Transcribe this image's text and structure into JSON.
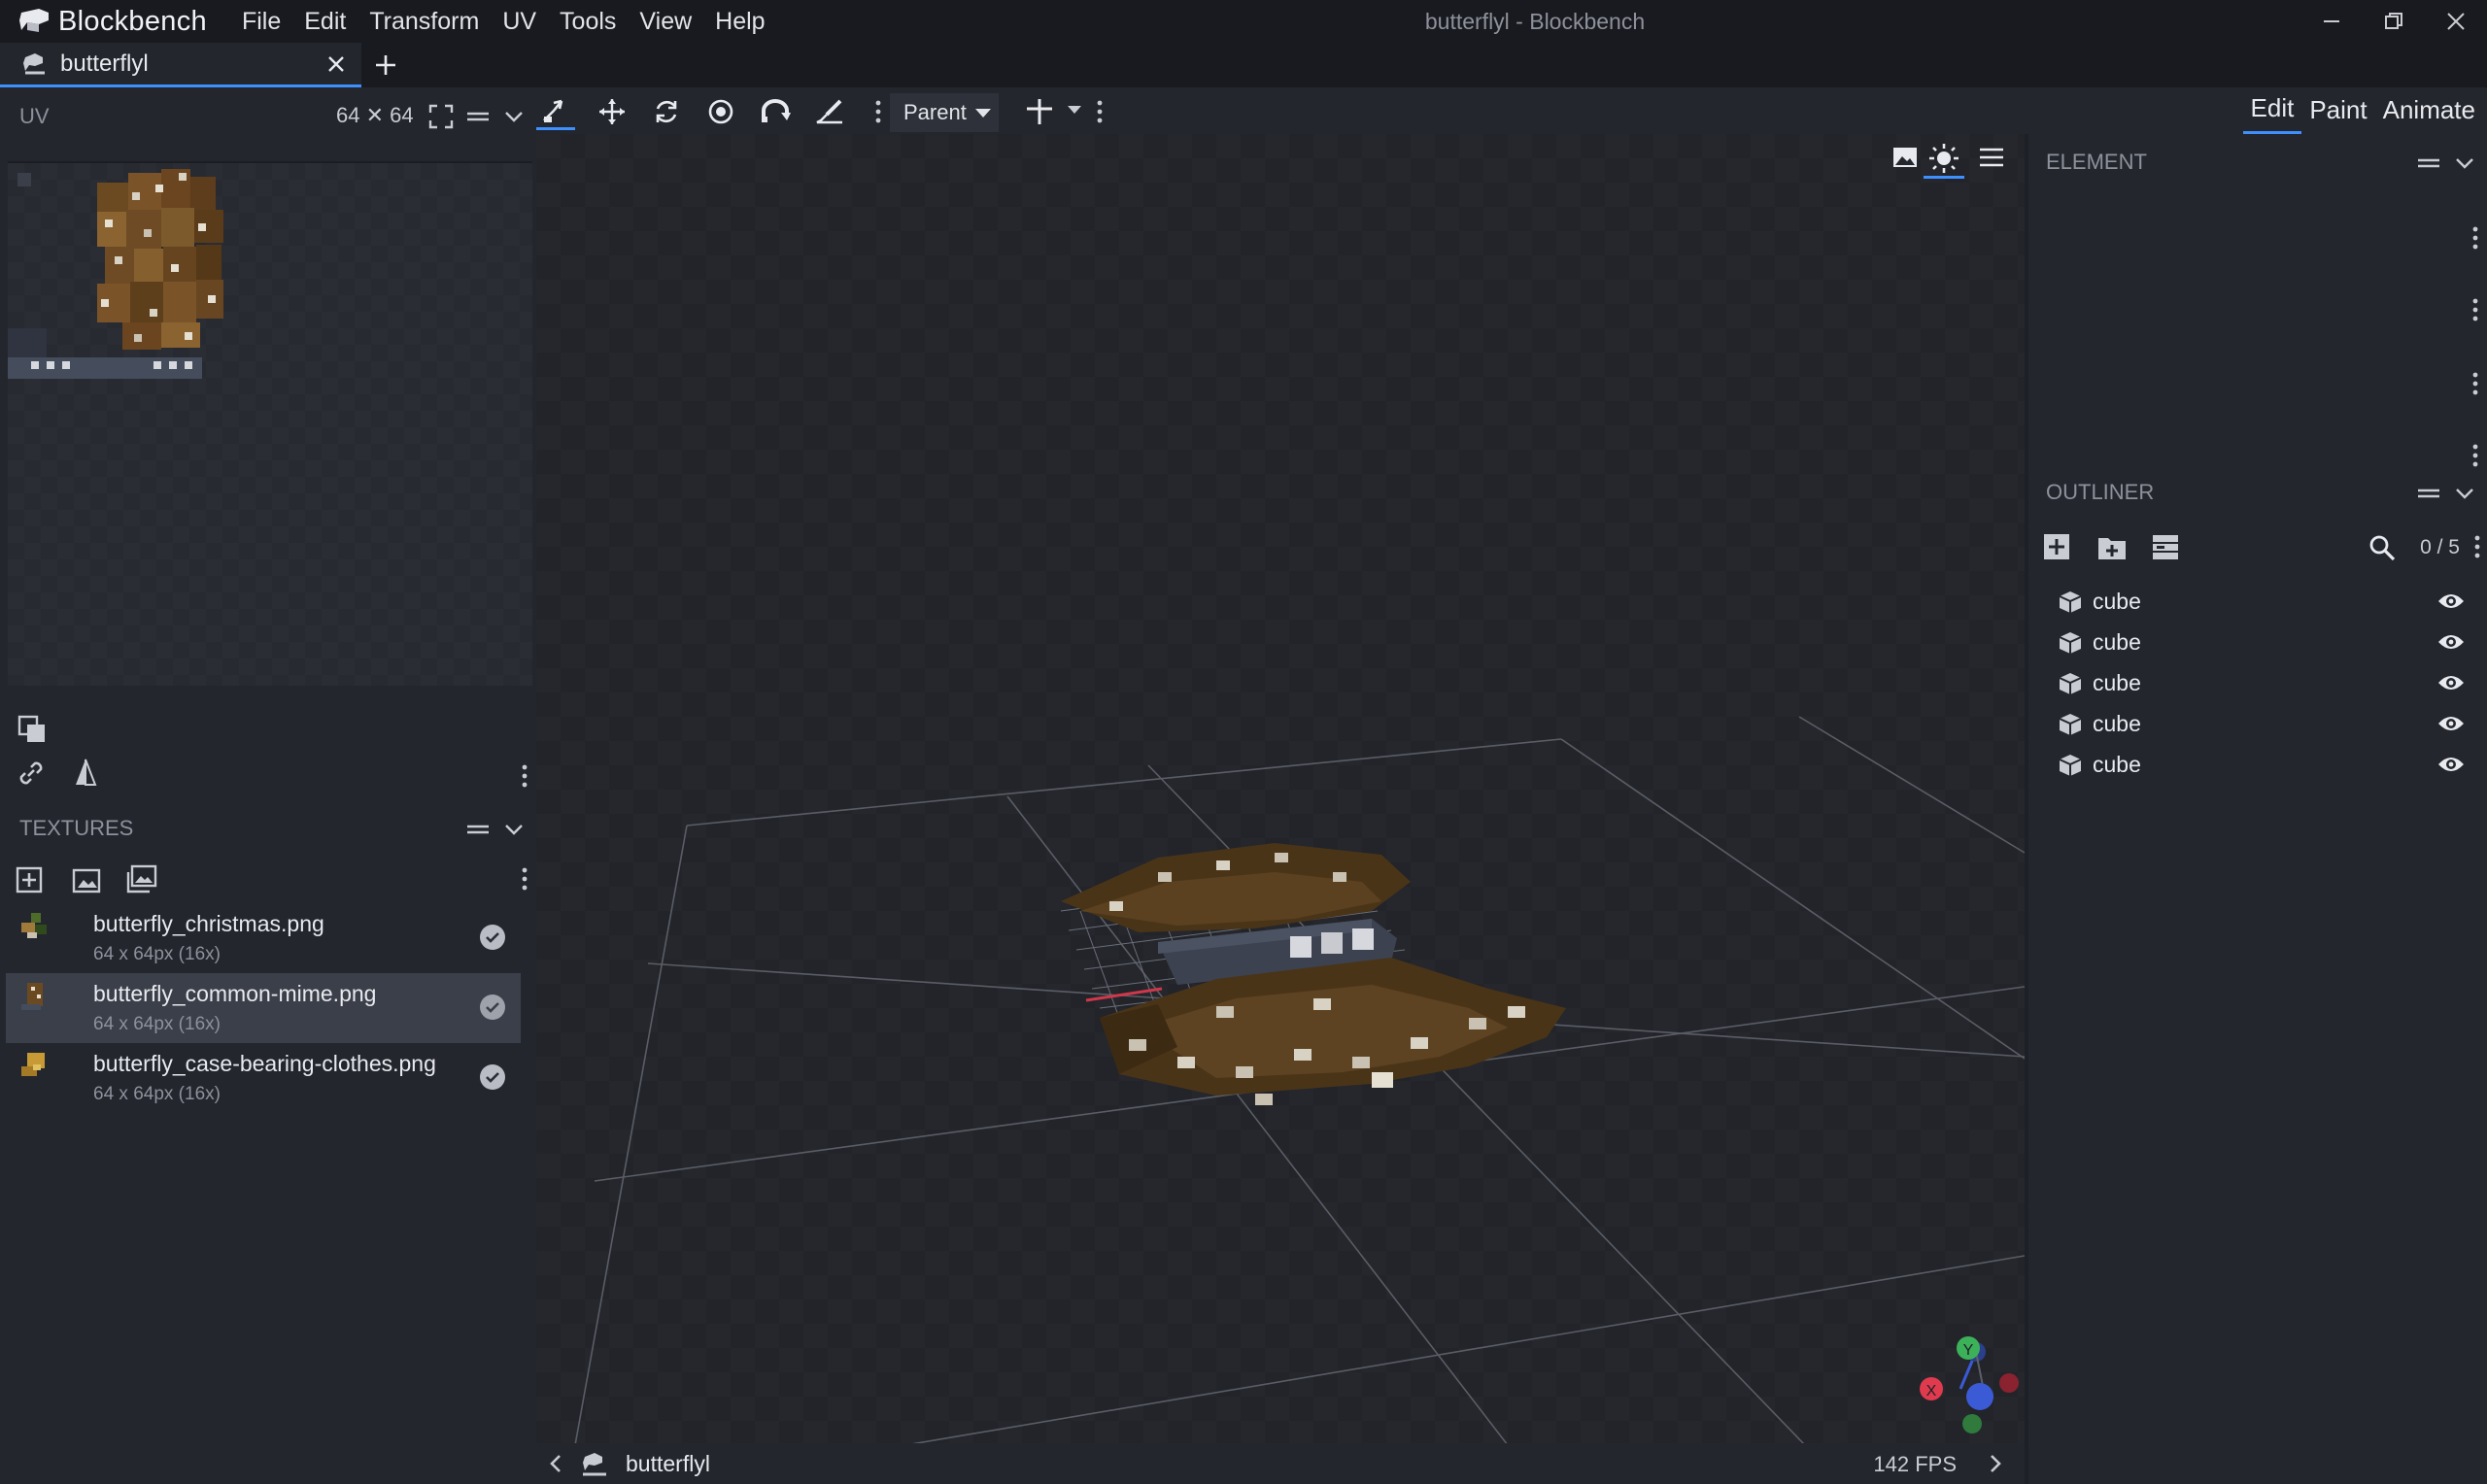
{
  "app": {
    "name": "Blockbench",
    "window_title": "butterflyl - Blockbench"
  },
  "menu": [
    "File",
    "Edit",
    "Transform",
    "UV",
    "Tools",
    "View",
    "Help"
  ],
  "tabs": [
    {
      "label": "butterflyl"
    }
  ],
  "uv_panel": {
    "title": "UV",
    "size": "64 ✕ 64"
  },
  "textures": {
    "title": "TEXTURES",
    "items": [
      {
        "name": "butterfly_christmas.png",
        "meta": "64 x 64px (16x)",
        "selected": false
      },
      {
        "name": "butterfly_common-mime.png",
        "meta": "64 x 64px (16x)",
        "selected": true
      },
      {
        "name": "butterfly_case-bearing-clothes.png",
        "meta": "64 x 64px (16x)",
        "selected": false
      }
    ]
  },
  "toolbar": {
    "pivot_mode": "Parent"
  },
  "modes": {
    "edit": "Edit",
    "paint": "Paint",
    "animate": "Animate",
    "active": "Edit"
  },
  "element_panel": {
    "title": "ELEMENT"
  },
  "outliner": {
    "title": "OUTLINER",
    "count": "0 / 5",
    "items": [
      {
        "label": "cube"
      },
      {
        "label": "cube"
      },
      {
        "label": "cube"
      },
      {
        "label": "cube"
      },
      {
        "label": "cube"
      }
    ]
  },
  "status": {
    "model_name": "butterflyl",
    "fps": "142 FPS"
  },
  "axes": {
    "x": "X",
    "y": "Y"
  },
  "colors": {
    "accent": "#3e90ff",
    "axis_x": "#e03a4e",
    "axis_y": "#3cb15a",
    "axis_z": "#3b5bd6"
  }
}
